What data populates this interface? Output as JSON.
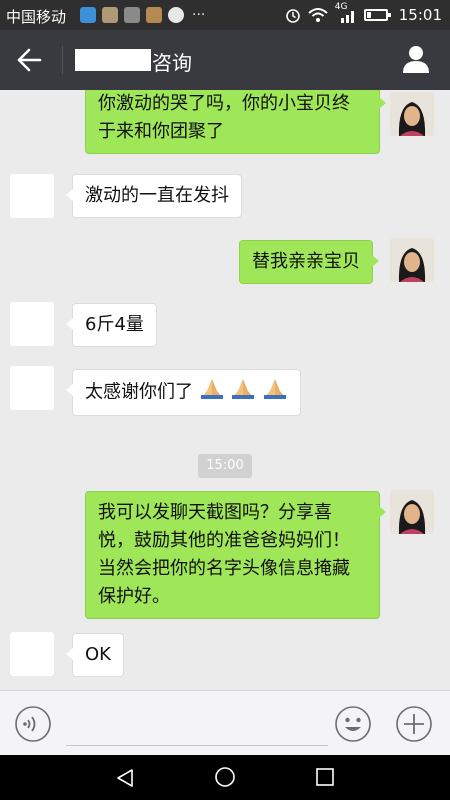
{
  "status_bar": {
    "carrier": "中国移动",
    "network": "4G",
    "time": "15:01"
  },
  "header": {
    "title": "咨询"
  },
  "messages": [
    {
      "sender": "me",
      "text": "你激动的哭了吗，你的小宝贝终于来和你团聚了"
    },
    {
      "sender": "other",
      "text": "激动的一直在发抖"
    },
    {
      "sender": "me",
      "text": "替我亲亲宝贝"
    },
    {
      "sender": "other",
      "text": "6斤4量"
    },
    {
      "sender": "other",
      "text": "太感谢你们了",
      "emoji_count": 3,
      "emoji": "folded-hands"
    },
    {
      "sender": "me",
      "text": "我可以发聊天截图吗？分享喜悦，鼓励其他的准爸爸妈妈们！当然会把你的名字头像信息掩藏保护好。"
    },
    {
      "sender": "other",
      "text": "OK"
    }
  ],
  "timestamp": "15:00",
  "input": {
    "placeholder": ""
  },
  "icons": {
    "back": "arrow-left-icon",
    "profile": "person-icon",
    "voice": "voice-icon",
    "emoji": "smiley-icon",
    "plus": "plus-icon",
    "nav": [
      "nav-back-icon",
      "nav-home-icon",
      "nav-recent-icon"
    ]
  },
  "colors": {
    "my_bubble": "#9fe658",
    "other_bubble": "#ffffff",
    "header": "#393a3f",
    "chat_bg": "#ebebeb"
  }
}
